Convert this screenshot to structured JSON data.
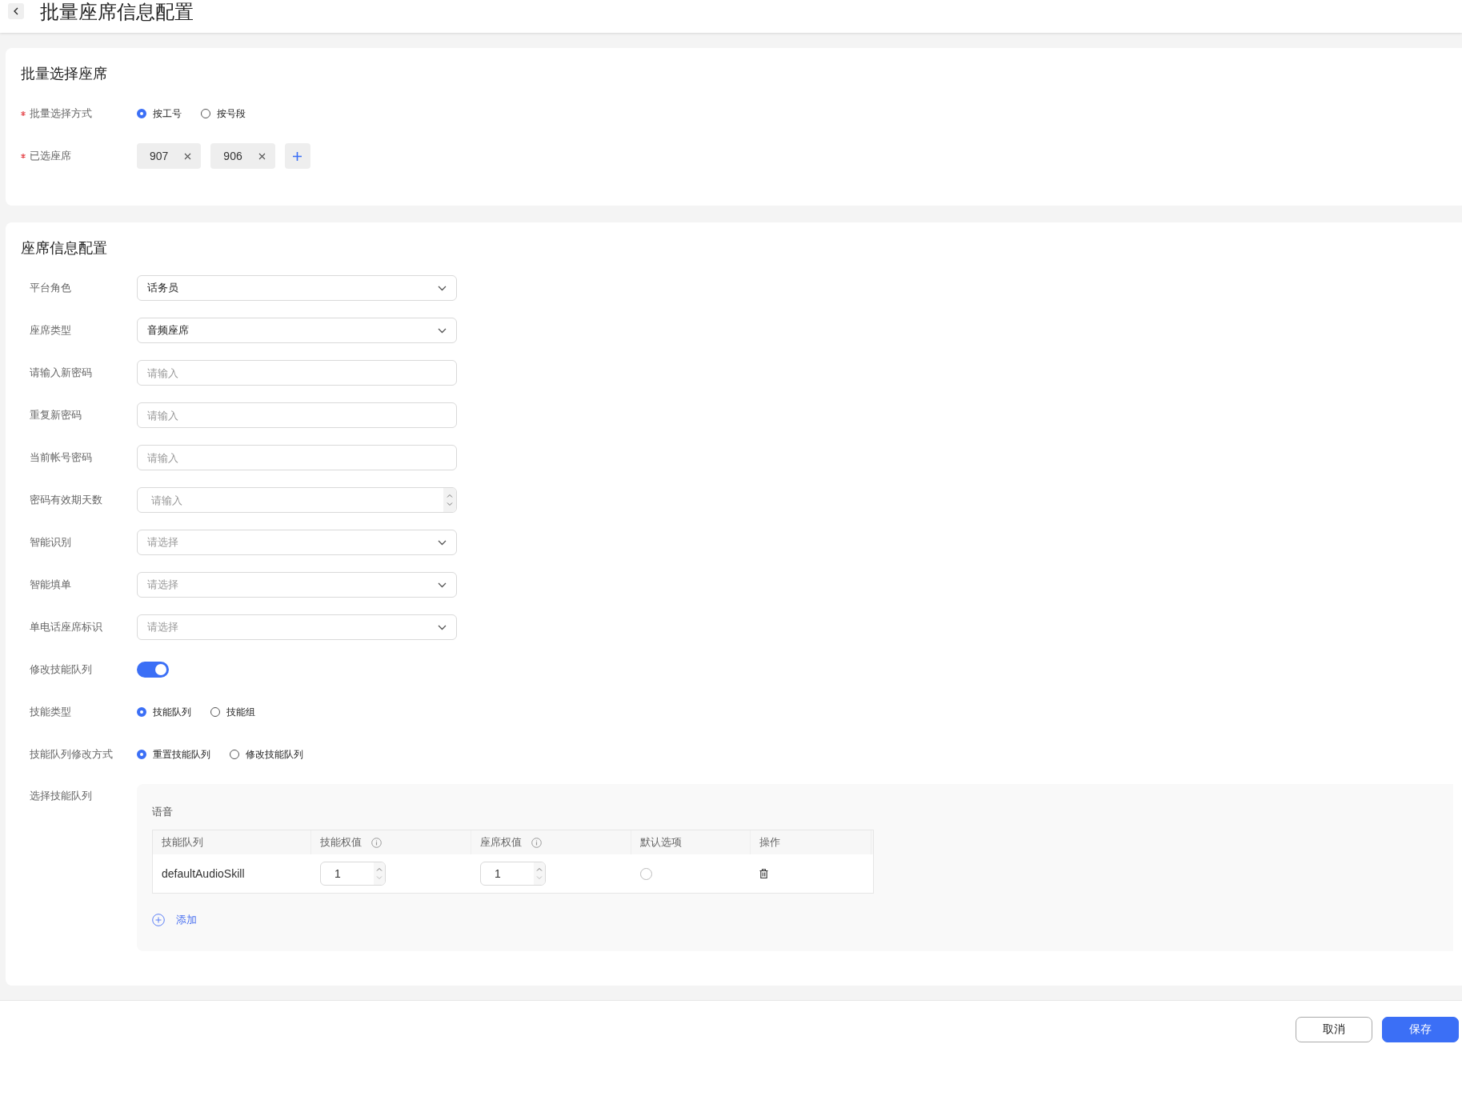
{
  "header": {
    "title": "批量座席信息配置"
  },
  "batch_section": {
    "title": "批量选择座席",
    "fields": [
      {
        "kind": "radio",
        "label": "批量选择方式",
        "required": true,
        "options": [
          {
            "label": "按工号",
            "selected": true
          },
          {
            "label": "按号段",
            "selected": false
          }
        ]
      },
      {
        "kind": "tags",
        "label": "已选座席",
        "required": true,
        "tags": [
          "907",
          "906"
        ]
      }
    ]
  },
  "config_section": {
    "title": "座席信息配置",
    "fields": [
      {
        "kind": "select",
        "label": "平台角色",
        "required": false,
        "value": "话务员"
      },
      {
        "kind": "select",
        "label": "座席类型",
        "required": false,
        "value": "音频座席"
      },
      {
        "kind": "input",
        "label": "请输入新密码",
        "required": false,
        "placeholder": "请输入"
      },
      {
        "kind": "input",
        "label": "重复新密码",
        "required": false,
        "placeholder": "请输入"
      },
      {
        "kind": "input",
        "label": "当前帐号密码",
        "required": false,
        "placeholder": "请输入"
      },
      {
        "kind": "number",
        "label": "密码有效期天数",
        "required": false,
        "placeholder": "请输入"
      },
      {
        "kind": "select",
        "label": "智能识别",
        "required": false,
        "placeholder": "请选择"
      },
      {
        "kind": "select",
        "label": "智能填单",
        "required": false,
        "placeholder": "请选择"
      },
      {
        "kind": "select",
        "label": "单电话座席标识",
        "required": false,
        "placeholder": "请选择"
      },
      {
        "kind": "switch",
        "label": "修改技能队列",
        "required": false,
        "on": true
      },
      {
        "kind": "radio",
        "label": "技能类型",
        "required": false,
        "options": [
          {
            "label": "技能队列",
            "selected": true
          },
          {
            "label": "技能组",
            "selected": false
          }
        ]
      },
      {
        "kind": "radio",
        "label": "技能队列修改方式",
        "required": false,
        "options": [
          {
            "label": "重置技能队列",
            "selected": true
          },
          {
            "label": "修改技能队列",
            "selected": false
          }
        ]
      },
      {
        "kind": "skills",
        "label": "选择技能队列",
        "required": false,
        "group_title": "语音",
        "columns": [
          {
            "label": "技能队列",
            "info": false
          },
          {
            "label": "技能权值",
            "info": true
          },
          {
            "label": "座席权值",
            "info": true
          },
          {
            "label": "默认选项",
            "info": false
          },
          {
            "label": "操作",
            "info": false
          }
        ],
        "rows": [
          {
            "skill": "defaultAudioSkill",
            "skill_weight": "1",
            "seat_weight": "1",
            "default": false
          }
        ],
        "add_label": "添加"
      }
    ]
  },
  "footer": {
    "buttons": [
      {
        "label": "取消",
        "kind": "secondary"
      },
      {
        "label": "保存",
        "kind": "primary"
      }
    ]
  }
}
